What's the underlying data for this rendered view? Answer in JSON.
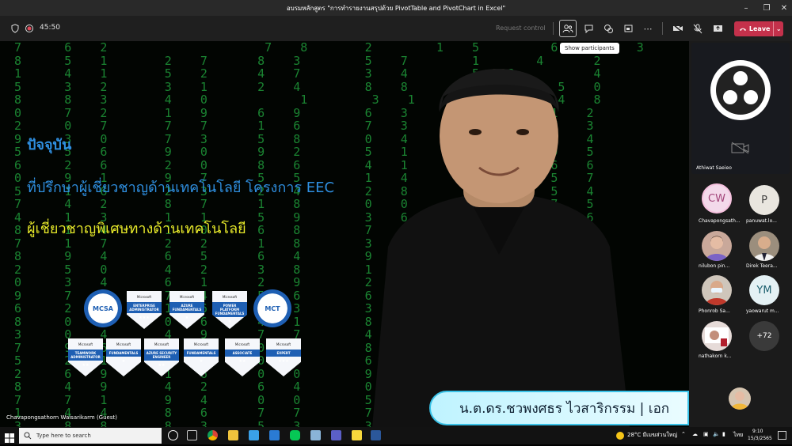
{
  "window": {
    "title": "อบรมหลักสูตร \"การทำรายงานสรุปด้วย PivotTable and PivotChart in Excel\""
  },
  "toolbar": {
    "timer": "45:50",
    "request_control": "Request control",
    "leave_label": "Leave",
    "tooltip": "Show participants"
  },
  "slide": {
    "heading": "ปัจจุบัน",
    "line1": "ที่ปรึกษาผู้เชี่ยวชาญด้านเทคโนโลยี โครงการ EEC",
    "line2": "ผู้เชี่ยวชาญพิเศษทางด้านเทคโนโลยี",
    "nameplate": "น.ต.ดร.ชวพงศธร ไวสาริกรรม | เอก",
    "badges_row1": [
      "MCSA",
      "ENTERPRISE ADMINISTRATOR",
      "AZURE FUNDAMENTALS",
      "POWER PLATFORM FUNDAMENTALS",
      "MCT"
    ],
    "badges_row2": [
      "TEAMWORK ADMINISTRATOR",
      "FUNDAMENTALS",
      "AZURE SECURITY ENGINEER",
      "FUNDAMENTALS",
      "ASSOCIATE",
      "EXPERT"
    ],
    "badge_brand": "Microsoft"
  },
  "presenter": {
    "label": "Chavapongsathorn Waisarikarm (Guest)"
  },
  "participants": {
    "main_name": "Athiwat Saeieo",
    "tiles": [
      {
        "initials": "CW",
        "name": "Chavapongsath..."
      },
      {
        "initials": "P",
        "name": "panuwat.lo..."
      },
      {
        "initials": "",
        "name": "nilubon pin..."
      },
      {
        "initials": "",
        "name": "Direk Teera..."
      },
      {
        "initials": "",
        "name": "Phonrob Sa..."
      },
      {
        "initials": "YM",
        "name": "yaowarut m..."
      },
      {
        "initials": "",
        "name": "nathakorn k..."
      },
      {
        "initials": "+72",
        "name": ""
      }
    ]
  },
  "taskbar": {
    "search_placeholder": "Type here to search",
    "weather": "28°C มีเมฆส่วนใหญ่",
    "lang": "ไทย",
    "time": "9:10",
    "date": "15/3/2565"
  }
}
